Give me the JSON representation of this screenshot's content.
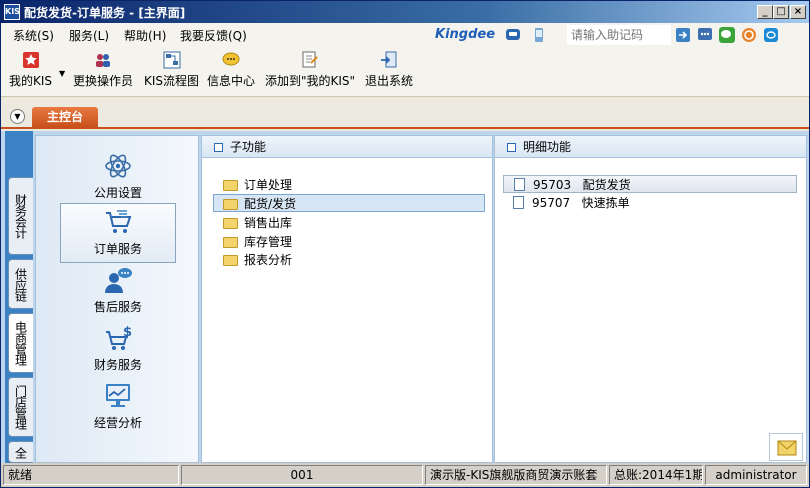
{
  "window": {
    "app_icon_text": "KIS",
    "title": "配货发货-订单服务 - [主界面]"
  },
  "menu": {
    "items": [
      "系统(S)",
      "服务(L)",
      "帮助(H)",
      "我要反馈(Q)"
    ],
    "brand": "Kingdee",
    "helper_placeholder": "请输入助记码"
  },
  "toolbar": {
    "buttons": [
      "我的KIS",
      "更换操作员",
      "KIS流程图",
      "信息中心",
      "添加到\"我的KIS\"",
      "退出系统"
    ]
  },
  "tabs": {
    "main": "主控台"
  },
  "vtabs": [
    "财务会计",
    "供应链",
    "电商管理",
    "门店管理",
    "全"
  ],
  "nav": {
    "items": [
      "公用设置",
      "订单服务",
      "售后服务",
      "财务服务",
      "经营分析"
    ],
    "selected": "订单服务"
  },
  "sub_panel": {
    "title": "子功能",
    "items": [
      "订单处理",
      "配货/发货",
      "销售出库",
      "库存管理",
      "报表分析"
    ],
    "selected": "配货/发货"
  },
  "detail_panel": {
    "title": "明细功能",
    "items": [
      {
        "code": "95703",
        "name": "配货发货"
      },
      {
        "code": "95707",
        "name": "快速拣单"
      }
    ]
  },
  "status": {
    "state": "就绪",
    "code": "001",
    "edition": "演示版-KIS旗舰版商贸演示账套",
    "period": "总账:2014年1期",
    "user": "administrator"
  },
  "colors": {
    "titlebar": "#0a246a",
    "accent_tab": "#c8501c",
    "nav_sidebar": "#3a82c4"
  }
}
